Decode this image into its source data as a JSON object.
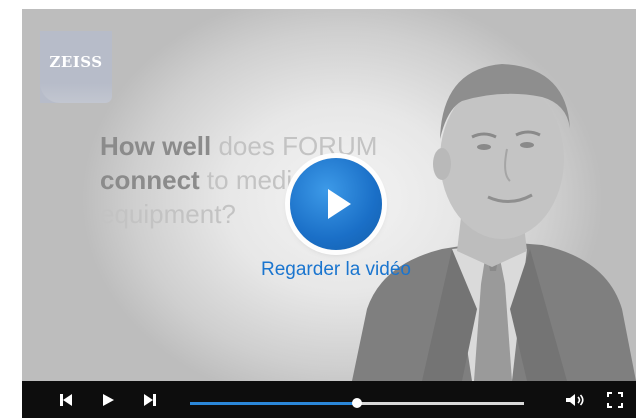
{
  "logo": {
    "text": "ZEISS"
  },
  "question": {
    "line1_strong": "How well",
    "line1_rest": " does FORUM",
    "line2_strong": "connect",
    "line2_rest": " to medical",
    "line3": "equipment?"
  },
  "overlay": {
    "watch_label": "Regarder la vidéo"
  },
  "controls": {
    "progress_fraction": 0.5,
    "icons": [
      "skip-back-icon",
      "play-icon",
      "skip-forward-icon",
      "volume-icon",
      "fullscreen-icon"
    ]
  },
  "colors": {
    "accent": "#1a75cf",
    "control_bar": "#0d0d0d",
    "progress": "#2b87d8"
  }
}
